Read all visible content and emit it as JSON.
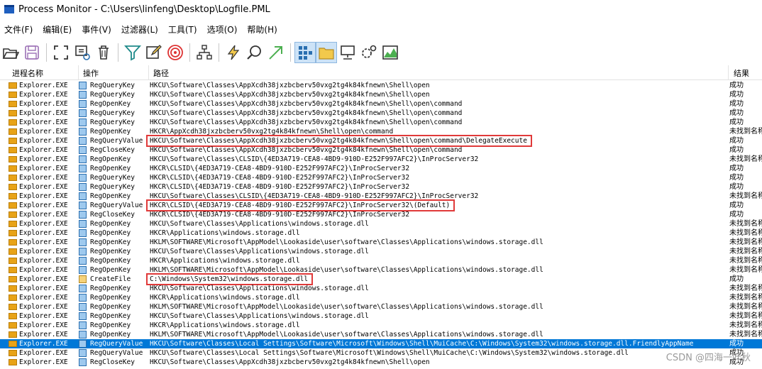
{
  "window": {
    "title": "Process Monitor - C:\\Users\\linfeng\\Desktop\\Logfile.PML"
  },
  "menu": [
    "文件(F)",
    "编辑(E)",
    "事件(V)",
    "过滤器(L)",
    "工具(T)",
    "选项(O)",
    "帮助(H)"
  ],
  "columns": {
    "process": "进程名称",
    "operation": "操作",
    "path": "路径",
    "result": "结果"
  },
  "colors": {
    "selection": "#0078d7",
    "highlight": "#e03a3a"
  },
  "rows": [
    {
      "process": "Explorer.EXE",
      "operation": "RegQueryKey",
      "path": "HKCU\\Software\\Classes\\AppXcdh38jxzbcberv50vxg2tg4k84kfnewn\\Shell\\open",
      "result": "成功"
    },
    {
      "process": "Explorer.EXE",
      "operation": "RegQueryKey",
      "path": "HKCU\\Software\\Classes\\AppXcdh38jxzbcberv50vxg2tg4k84kfnewn\\Shell\\open",
      "result": "成功"
    },
    {
      "process": "Explorer.EXE",
      "operation": "RegOpenKey",
      "path": "HKCU\\Software\\Classes\\AppXcdh38jxzbcberv50vxg2tg4k84kfnewn\\Shell\\open\\command",
      "result": "成功"
    },
    {
      "process": "Explorer.EXE",
      "operation": "RegQueryKey",
      "path": "HKCU\\Software\\Classes\\AppXcdh38jxzbcberv50vxg2tg4k84kfnewn\\Shell\\open\\command",
      "result": "成功"
    },
    {
      "process": "Explorer.EXE",
      "operation": "RegQueryKey",
      "path": "HKCU\\Software\\Classes\\AppXcdh38jxzbcberv50vxg2tg4k84kfnewn\\Shell\\open\\command",
      "result": "成功"
    },
    {
      "process": "Explorer.EXE",
      "operation": "RegOpenKey",
      "path": "HKCR\\AppXcdh38jxzbcberv50vxg2tg4k84kfnewn\\Shell\\open\\command",
      "result": "未找到名称"
    },
    {
      "process": "Explorer.EXE",
      "operation": "RegQueryValue",
      "path": "HKCU\\Software\\Classes\\AppXcdh38jxzbcberv50vxg2tg4k84kfnewn\\Shell\\open\\command\\DelegateExecute",
      "result": "成功",
      "highlight": true
    },
    {
      "process": "Explorer.EXE",
      "operation": "RegCloseKey",
      "path": "HKCU\\Software\\Classes\\AppXcdh38jxzbcberv50vxg2tg4k84kfnewn\\Shell\\open\\command",
      "result": "成功"
    },
    {
      "process": "Explorer.EXE",
      "operation": "RegOpenKey",
      "path": "HKCU\\Software\\Classes\\CLSID\\{4ED3A719-CEA8-4BD9-910D-E252F997AFC2}\\InProcServer32",
      "result": "未找到名称"
    },
    {
      "process": "Explorer.EXE",
      "operation": "RegOpenKey",
      "path": "HKCR\\CLSID\\{4ED3A719-CEA8-4BD9-910D-E252F997AFC2}\\InProcServer32",
      "result": "成功"
    },
    {
      "process": "Explorer.EXE",
      "operation": "RegQueryKey",
      "path": "HKCR\\CLSID\\{4ED3A719-CEA8-4BD9-910D-E252F997AFC2}\\InProcServer32",
      "result": "成功"
    },
    {
      "process": "Explorer.EXE",
      "operation": "RegQueryKey",
      "path": "HKCR\\CLSID\\{4ED3A719-CEA8-4BD9-910D-E252F997AFC2}\\InProcServer32",
      "result": "成功"
    },
    {
      "process": "Explorer.EXE",
      "operation": "RegOpenKey",
      "path": "HKCU\\Software\\Classes\\CLSID\\{4ED3A719-CEA8-4BD9-910D-E252F997AFC2}\\InProcServer32",
      "result": "未找到名称"
    },
    {
      "process": "Explorer.EXE",
      "operation": "RegQueryValue",
      "path": "HKCR\\CLSID\\{4ED3A719-CEA8-4BD9-910D-E252F997AFC2}\\InProcServer32\\(Default)",
      "result": "成功",
      "highlight": true
    },
    {
      "process": "Explorer.EXE",
      "operation": "RegCloseKey",
      "path": "HKCR\\CLSID\\{4ED3A719-CEA8-4BD9-910D-E252F997AFC2}\\InProcServer32",
      "result": "成功"
    },
    {
      "process": "Explorer.EXE",
      "operation": "RegOpenKey",
      "path": "HKCU\\Software\\Classes\\Applications\\windows.storage.dll",
      "result": "未找到名称"
    },
    {
      "process": "Explorer.EXE",
      "operation": "RegOpenKey",
      "path": "HKCR\\Applications\\windows.storage.dll",
      "result": "未找到名称"
    },
    {
      "process": "Explorer.EXE",
      "operation": "RegOpenKey",
      "path": "HKLM\\SOFTWARE\\Microsoft\\AppModel\\Lookaside\\user\\software\\Classes\\Applications\\windows.storage.dll",
      "result": "未找到名称"
    },
    {
      "process": "Explorer.EXE",
      "operation": "RegOpenKey",
      "path": "HKCU\\Software\\Classes\\Applications\\windows.storage.dll",
      "result": "未找到名称"
    },
    {
      "process": "Explorer.EXE",
      "operation": "RegOpenKey",
      "path": "HKCR\\Applications\\windows.storage.dll",
      "result": "未找到名称"
    },
    {
      "process": "Explorer.EXE",
      "operation": "RegOpenKey",
      "path": "HKLM\\SOFTWARE\\Microsoft\\AppModel\\Lookaside\\user\\software\\Classes\\Applications\\windows.storage.dll",
      "result": "未找到名称"
    },
    {
      "process": "Explorer.EXE",
      "operation": "CreateFile",
      "path": "C:\\Windows\\System32\\windows.storage.dll",
      "result": "成功",
      "highlight": true,
      "file": true
    },
    {
      "process": "Explorer.EXE",
      "operation": "RegOpenKey",
      "path": "HKCU\\Software\\Classes\\Applications\\windows.storage.dll",
      "result": "未找到名称"
    },
    {
      "process": "Explorer.EXE",
      "operation": "RegOpenKey",
      "path": "HKCR\\Applications\\windows.storage.dll",
      "result": "未找到名称"
    },
    {
      "process": "Explorer.EXE",
      "operation": "RegOpenKey",
      "path": "HKLM\\SOFTWARE\\Microsoft\\AppModel\\Lookaside\\user\\software\\Classes\\Applications\\windows.storage.dll",
      "result": "未找到名称"
    },
    {
      "process": "Explorer.EXE",
      "operation": "RegOpenKey",
      "path": "HKCU\\Software\\Classes\\Applications\\windows.storage.dll",
      "result": "未找到名称"
    },
    {
      "process": "Explorer.EXE",
      "operation": "RegOpenKey",
      "path": "HKCR\\Applications\\windows.storage.dll",
      "result": "未找到名称"
    },
    {
      "process": "Explorer.EXE",
      "operation": "RegOpenKey",
      "path": "HKLM\\SOFTWARE\\Microsoft\\AppModel\\Lookaside\\user\\software\\Classes\\Applications\\windows.storage.dll",
      "result": "未找到名称"
    },
    {
      "process": "Explorer.EXE",
      "operation": "RegQueryValue",
      "path": "HKCU\\Software\\Classes\\Local Settings\\Software\\Microsoft\\Windows\\Shell\\MuiCache\\C:\\Windows\\System32\\windows.storage.dll.FriendlyAppName",
      "result": "成功",
      "selected": true
    },
    {
      "process": "Explorer.EXE",
      "operation": "RegQueryValue",
      "path": "HKCU\\Software\\Classes\\Local Settings\\Software\\Microsoft\\Windows\\Shell\\MuiCache\\C:\\Windows\\System32\\windows.storage.dll",
      "result": "成功"
    },
    {
      "process": "Explorer.EXE",
      "operation": "RegCloseKey",
      "path": "HKCU\\Software\\Classes\\AppXcdh38jxzbcberv50vxg2tg4k84kfnewn\\Shell\\open",
      "result": "成功"
    }
  ],
  "watermark": "CSDN @四海一叶秋"
}
